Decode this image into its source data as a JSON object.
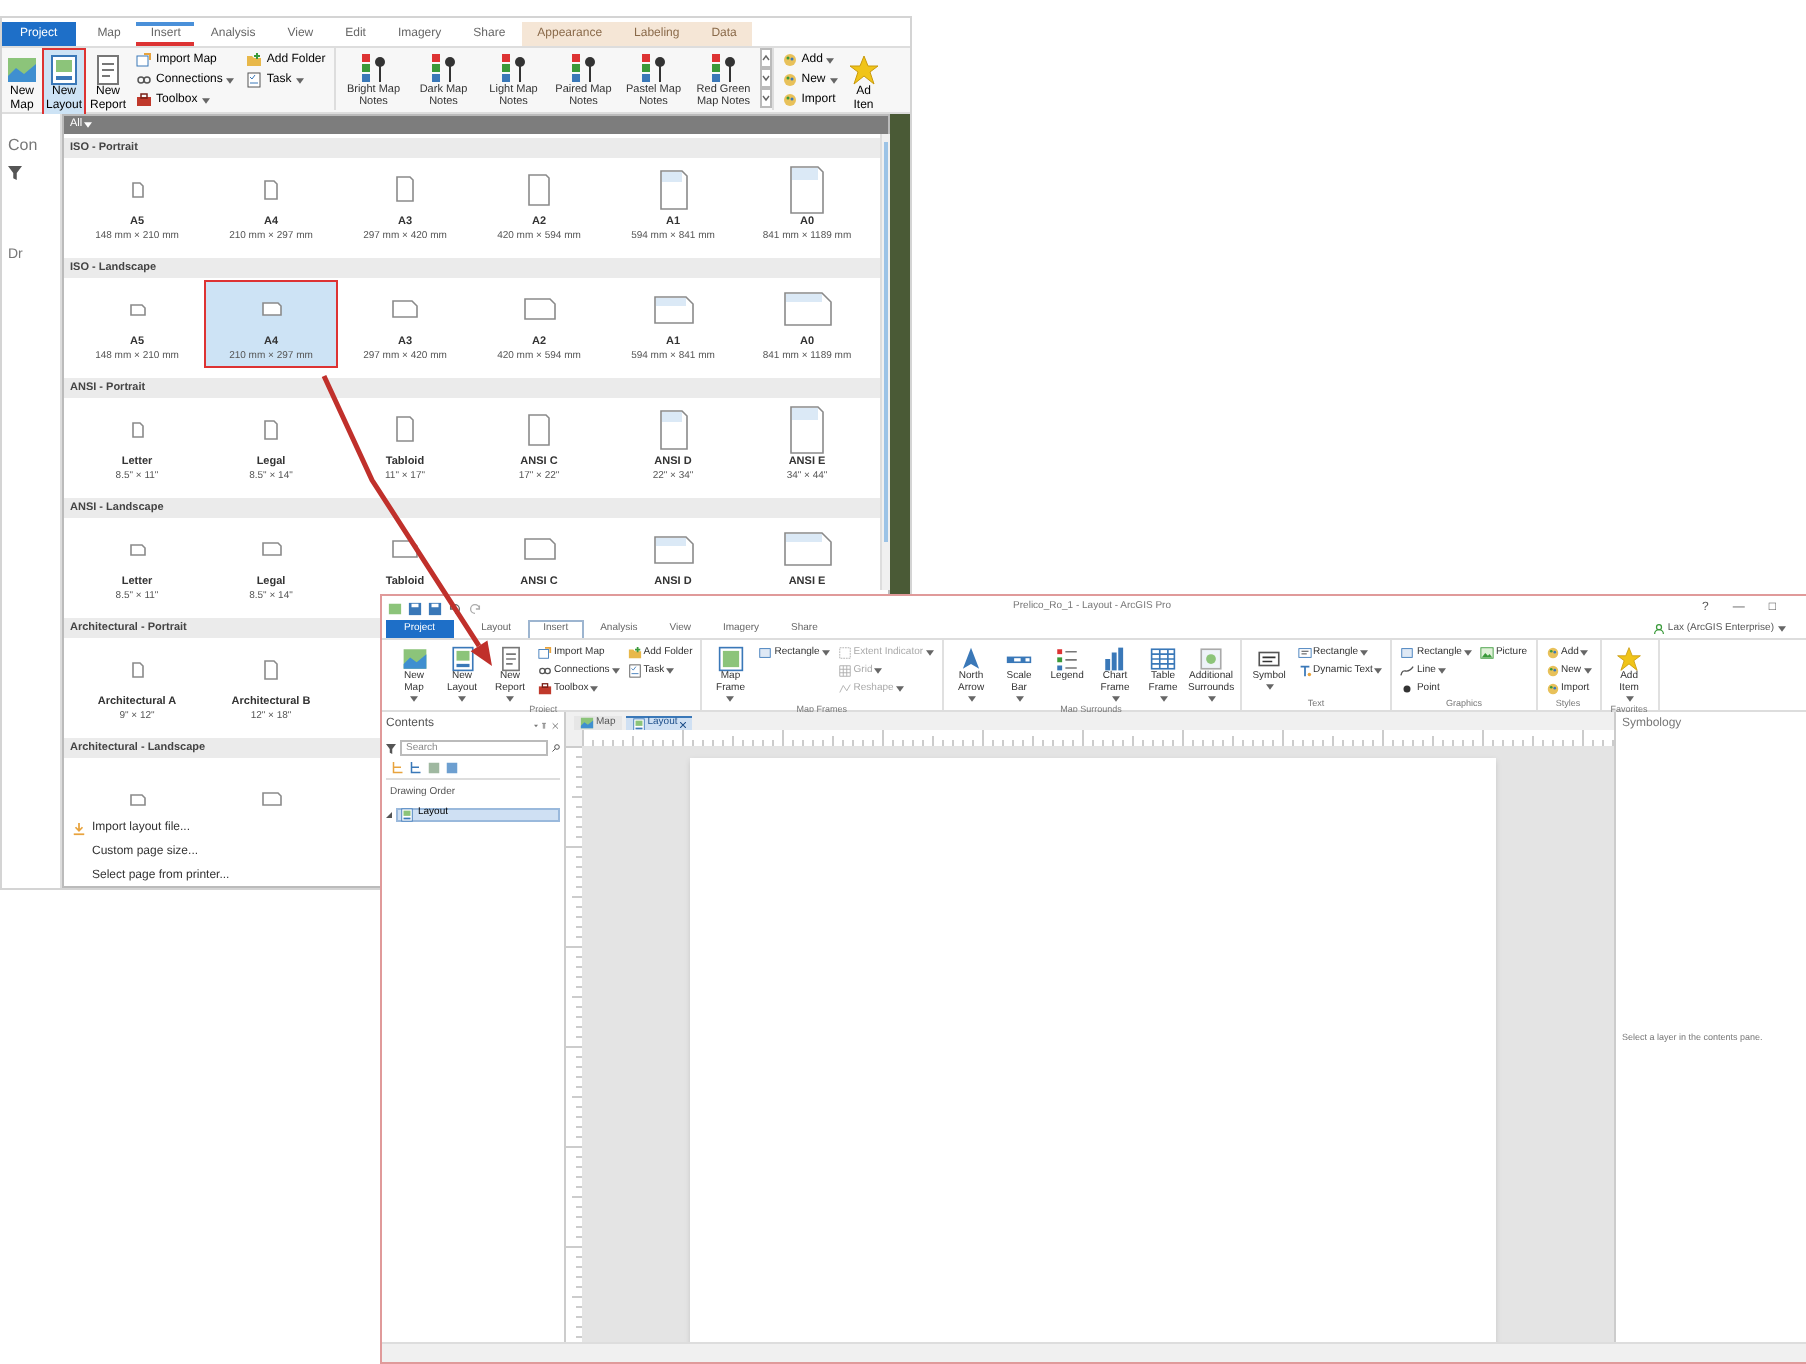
{
  "back_window": {
    "tabs": [
      {
        "label": "Project",
        "kind": "file",
        "selected": false
      },
      {
        "label": "Map",
        "kind": "core",
        "selected": false
      },
      {
        "label": "Insert",
        "kind": "core",
        "selected": true
      },
      {
        "label": "Analysis",
        "kind": "core",
        "selected": false
      },
      {
        "label": "View",
        "kind": "core",
        "selected": false
      },
      {
        "label": "Edit",
        "kind": "core",
        "selected": false
      },
      {
        "label": "Imagery",
        "kind": "core",
        "selected": false
      },
      {
        "label": "Share",
        "kind": "core",
        "selected": false
      },
      {
        "label": "Appearance",
        "kind": "contextual",
        "selected": false
      },
      {
        "label": "Labeling",
        "kind": "contextual",
        "selected": false
      },
      {
        "label": "Data",
        "kind": "contextual",
        "selected": false
      }
    ],
    "ribbon": [
      {
        "kind": "large",
        "label": "New Map",
        "dropdown": true,
        "selected": false
      },
      {
        "kind": "large",
        "label": "New Layout",
        "dropdown": true,
        "selected": true
      },
      {
        "kind": "large",
        "label": "New Report",
        "dropdown": true,
        "selected": false
      },
      {
        "kind": "stack",
        "buttons": [
          {
            "label": "Import Map",
            "dropdown": false,
            "selected": false
          },
          {
            "label": "Connections",
            "dropdown": true,
            "selected": false
          },
          {
            "label": "Toolbox",
            "dropdown": true,
            "selected": false
          }
        ]
      },
      {
        "kind": "stack",
        "buttons": [
          {
            "label": "Add Folder",
            "dropdown": false,
            "selected": false
          },
          {
            "label": "Task",
            "dropdown": true,
            "selected": false
          }
        ]
      },
      {
        "kind": "gallery",
        "items": [
          {
            "label": "Bright Map Notes"
          },
          {
            "label": "Dark Map Notes"
          },
          {
            "label": "Light Map Notes"
          },
          {
            "label": "Paired Map Notes"
          },
          {
            "label": "Pastel Map Notes"
          },
          {
            "label": "Red Green Map Notes"
          }
        ]
      },
      {
        "kind": "stack",
        "buttons": [
          {
            "label": "Add",
            "dropdown": true,
            "selected": false
          },
          {
            "label": "New",
            "dropdown": true,
            "selected": false
          },
          {
            "label": "Import",
            "dropdown": false,
            "selected": false
          }
        ]
      },
      {
        "kind": "large",
        "label": "Ad Iten",
        "dropdown": false,
        "selected": false
      }
    ],
    "side_pane": {
      "title": "Con",
      "heading": "Dr"
    },
    "gallery": {
      "filter": "All",
      "sections": [
        {
          "title": "ISO - Portrait",
          "kind": "portrait",
          "items": [
            {
              "name": "A5",
              "size": "148 mm × 210 mm",
              "selected": false
            },
            {
              "name": "A4",
              "size": "210 mm × 297 mm",
              "selected": false
            },
            {
              "name": "A3",
              "size": "297 mm × 420 mm",
              "selected": false
            },
            {
              "name": "A2",
              "size": "420 mm × 594 mm",
              "selected": false
            },
            {
              "name": "A1",
              "size": "594 mm × 841 mm",
              "selected": false
            },
            {
              "name": "A0",
              "size": "841 mm × 1189 mm",
              "selected": false
            }
          ]
        },
        {
          "title": "ISO - Landscape",
          "kind": "landscape",
          "items": [
            {
              "name": "A5",
              "size": "148 mm × 210 mm",
              "selected": false
            },
            {
              "name": "A4",
              "size": "210 mm × 297 mm",
              "selected": true
            },
            {
              "name": "A3",
              "size": "297 mm × 420 mm",
              "selected": false
            },
            {
              "name": "A2",
              "size": "420 mm × 594 mm",
              "selected": false
            },
            {
              "name": "A1",
              "size": "594 mm × 841 mm",
              "selected": false
            },
            {
              "name": "A0",
              "size": "841 mm × 1189 mm",
              "selected": false
            }
          ]
        },
        {
          "title": "ANSI - Portrait",
          "kind": "portrait",
          "items": [
            {
              "name": "Letter",
              "size": "8.5\" × 11\"",
              "selected": false
            },
            {
              "name": "Legal",
              "size": "8.5\" × 14\"",
              "selected": false
            },
            {
              "name": "Tabloid",
              "size": "11\" × 17\"",
              "selected": false
            },
            {
              "name": "ANSI C",
              "size": "17\" × 22\"",
              "selected": false
            },
            {
              "name": "ANSI D",
              "size": "22\" × 34\"",
              "selected": false
            },
            {
              "name": "ANSI E",
              "size": "34\" × 44\"",
              "selected": false
            }
          ]
        },
        {
          "title": "ANSI - Landscape",
          "kind": "landscape",
          "items": [
            {
              "name": "Letter",
              "size": "8.5\" × 11\"",
              "selected": false
            },
            {
              "name": "Legal",
              "size": "8.5\" × 14\"",
              "selected": false
            },
            {
              "name": "Tabloid",
              "selected": false
            },
            {
              "name": "ANSI C",
              "selected": false
            },
            {
              "name": "ANSI D",
              "selected": false
            },
            {
              "name": "ANSI E",
              "selected": false
            }
          ]
        },
        {
          "title": "Architectural - Portrait",
          "kind": "portrait",
          "items": [
            {
              "name": "Architectural A",
              "size": "9\" × 12\"",
              "selected": false
            },
            {
              "name": "Architectural B",
              "size": "12\" × 18\"",
              "selected": false
            }
          ]
        },
        {
          "title": "Architectural - Landscape",
          "kind": "landscape",
          "items": [
            {
              "selected": false
            },
            {
              "selected": false
            }
          ]
        }
      ],
      "commands": [
        {
          "label": "Import layout file..."
        },
        {
          "label": "Custom page size..."
        },
        {
          "label": "Select page from printer..."
        }
      ]
    }
  },
  "front_window": {
    "title": "Prelico_Ro_1 - Layout - ArcGIS Pro",
    "window_controls": [
      "?",
      "—",
      "□"
    ],
    "account": "Lax (ArcGIS Enterprise)",
    "tabs": [
      {
        "label": "Project",
        "kind": "file",
        "selected": false
      },
      {
        "label": "Layout",
        "kind": "core",
        "selected": false
      },
      {
        "label": "Insert",
        "kind": "core",
        "selected": true
      },
      {
        "label": "Analysis",
        "kind": "core",
        "selected": false
      },
      {
        "label": "View",
        "kind": "core",
        "selected": false
      },
      {
        "label": "Imagery",
        "kind": "core",
        "selected": false
      },
      {
        "label": "Share",
        "kind": "core",
        "selected": false
      }
    ],
    "ribbon": [
      {
        "title": "Project",
        "items": [
          {
            "kind": "large",
            "label": "New Map",
            "dropdown": true,
            "disabled": false
          },
          {
            "kind": "large",
            "label": "New Layout",
            "dropdown": true,
            "disabled": false
          },
          {
            "kind": "large",
            "label": "New Report",
            "dropdown": true,
            "disabled": false
          },
          {
            "kind": "stack",
            "buttons": [
              {
                "label": "Import Map",
                "dropdown": false,
                "disabled": false
              },
              {
                "label": "Connections",
                "dropdown": true,
                "disabled": false
              },
              {
                "label": "Toolbox",
                "dropdown": true,
                "disabled": false
              }
            ]
          },
          {
            "kind": "stack",
            "buttons": [
              {
                "label": "Add Folder",
                "dropdown": false,
                "disabled": false
              },
              {
                "label": "Task",
                "dropdown": true,
                "disabled": false
              }
            ]
          }
        ]
      },
      {
        "title": "Map Frames",
        "items": [
          {
            "kind": "large",
            "label": "Map Frame",
            "dropdown": true,
            "disabled": false
          },
          {
            "kind": "stack",
            "buttons": [
              {
                "label": "Rectangle",
                "dropdown": true,
                "disabled": false
              }
            ]
          },
          {
            "kind": "stack",
            "buttons": [
              {
                "label": "Extent Indicator",
                "dropdown": true,
                "disabled": true
              },
              {
                "label": "Grid",
                "dropdown": true,
                "disabled": true
              },
              {
                "label": "Reshape",
                "dropdown": true,
                "disabled": true
              }
            ]
          }
        ]
      },
      {
        "title": "Map Surrounds",
        "items": [
          {
            "kind": "large",
            "label": "North Arrow",
            "dropdown": true,
            "disabled": false
          },
          {
            "kind": "large",
            "label": "Scale Bar",
            "dropdown": true,
            "disabled": false
          },
          {
            "kind": "large",
            "label": "Legend",
            "dropdown": false,
            "disabled": false
          },
          {
            "kind": "large",
            "label": "Chart Frame",
            "dropdown": true,
            "disabled": false
          },
          {
            "kind": "large",
            "label": "Table Frame",
            "dropdown": true,
            "disabled": false
          },
          {
            "kind": "large",
            "label": "Additional Surrounds",
            "dropdown": true,
            "disabled": false
          }
        ]
      },
      {
        "title": "Text",
        "items": [
          {
            "kind": "large",
            "label": "Symbol",
            "dropdown": true,
            "disabled": false
          },
          {
            "kind": "stack",
            "buttons": [
              {
                "label": "Rectangle",
                "dropdown": true,
                "disabled": false
              },
              {
                "label": "Dynamic Text",
                "dropdown": true,
                "disabled": false
              }
            ]
          }
        ]
      },
      {
        "title": "Graphics",
        "items": [
          {
            "kind": "stack",
            "buttons": [
              {
                "label": "Rectangle",
                "dropdown": true,
                "disabled": false
              },
              {
                "label": "Line",
                "dropdown": true,
                "disabled": false
              },
              {
                "label": "Point",
                "dropdown": false,
                "disabled": false
              }
            ]
          },
          {
            "kind": "stack",
            "buttons": [
              {
                "label": "Picture",
                "dropdown": false,
                "disabled": false
              }
            ]
          }
        ]
      },
      {
        "title": "Styles",
        "items": [
          {
            "kind": "stack",
            "buttons": [
              {
                "label": "Add",
                "dropdown": true,
                "disabled": false
              },
              {
                "label": "New",
                "dropdown": true,
                "disabled": false
              },
              {
                "label": "Import",
                "dropdown": false,
                "disabled": false
              }
            ]
          }
        ]
      },
      {
        "title": "Favorites",
        "items": [
          {
            "kind": "large",
            "label": "Add Item",
            "dropdown": true,
            "disabled": false
          }
        ]
      }
    ],
    "contents": {
      "title": "Contents",
      "search_placeholder": "Search",
      "heading": "Drawing Order",
      "items": [
        {
          "label": "Layout",
          "selected": true,
          "expanded": true
        }
      ]
    },
    "view_tabs": [
      {
        "label": "Map",
        "selected": false
      },
      {
        "label": "Layout",
        "selected": true
      }
    ],
    "symbology": {
      "title": "Symbology",
      "message": "Select a layer in the contents pane."
    }
  }
}
